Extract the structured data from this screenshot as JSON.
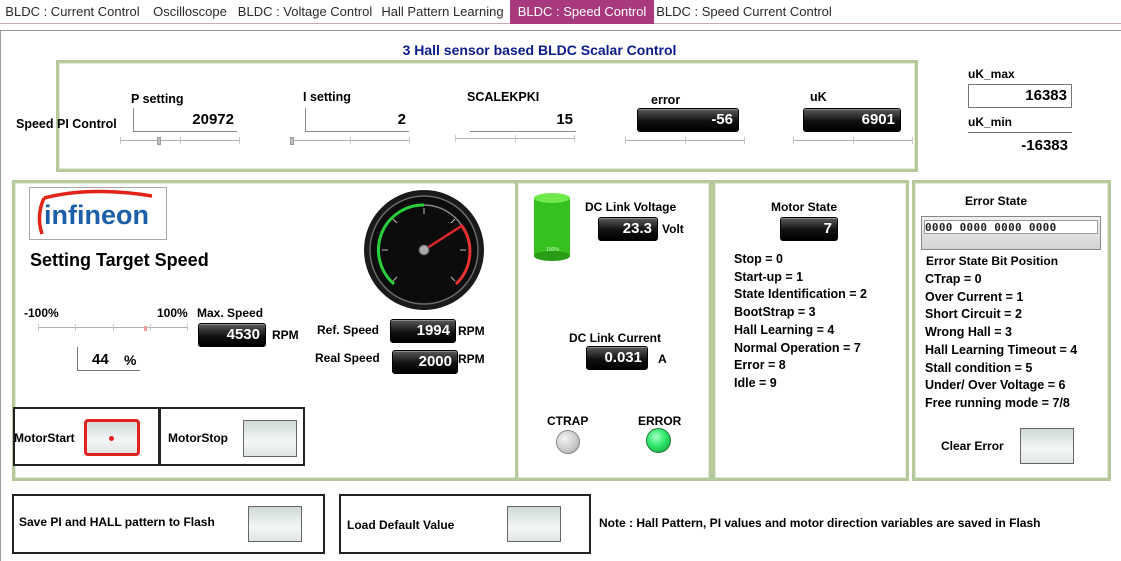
{
  "tabs": [
    {
      "label": "BLDC : Current  Control",
      "active": false
    },
    {
      "label": "Oscilloscope",
      "active": false
    },
    {
      "label": "BLDC : Voltage Control",
      "active": false
    },
    {
      "label": "Hall Pattern Learning",
      "active": false
    },
    {
      "label": "BLDC : Speed Control",
      "active": true
    },
    {
      "label": "BLDC : Speed Current Control",
      "active": false
    }
  ],
  "title": "3 Hall sensor based BLDC Scalar Control",
  "pi": {
    "section_label": "Speed PI Control",
    "p_label": "P setting",
    "p_value": "20972",
    "i_label": "I setting",
    "i_value": "2",
    "scale_label": "SCALEKPKI",
    "scale_value": "15",
    "error_label": "error",
    "error_value": "-56",
    "uk_label": "uK",
    "uk_value": "6901",
    "uk_max_label": "uK_max",
    "uk_max_value": "16383",
    "uk_min_label": "uK_min",
    "uk_min_value": "-16383"
  },
  "speed": {
    "logo_text": "infineon",
    "heading": "Setting Target Speed",
    "min_label": "-100%",
    "max_label": "100%",
    "percent_value": "44",
    "percent_unit": "%",
    "max_speed_label": "Max. Speed",
    "max_speed_value": "4530",
    "max_speed_unit": "RPM",
    "ref_label": "Ref. Speed",
    "ref_value": "1994",
    "ref_unit": "RPM",
    "real_label": "Real Speed",
    "real_value": "2000",
    "real_unit": "RPM",
    "start_label": "MotorStart",
    "stop_label": "MotorStop"
  },
  "dc": {
    "voltage_label": "DC Link Voltage",
    "voltage_value": "23.3",
    "voltage_unit": "Volt",
    "tank_label": "100%",
    "current_label": "DC Link Current",
    "current_value": "0.031",
    "current_unit": "A",
    "ctrap_label": "CTRAP",
    "error_label": "ERROR"
  },
  "motor_state": {
    "label": "Motor State",
    "value": "7",
    "items": [
      "Stop = 0",
      "Start-up = 1",
      "State Identification = 2",
      "BootStrap = 3",
      "Hall Learning = 4",
      "Normal Operation = 7",
      "Error = 8",
      "Idle = 9"
    ]
  },
  "error_state": {
    "label": "Error State",
    "bits": "0000 0000 0000 0000",
    "bit_position_label": "Error State Bit Position",
    "items": [
      "CTrap = 0",
      "Over Current = 1",
      "Short Circuit = 2",
      "Wrong Hall = 3",
      "Hall Learning Timeout = 4",
      "Stall condition = 5",
      "Under/ Over Voltage = 6",
      "Free running mode = 7/8"
    ],
    "clear_label": "Clear Error"
  },
  "flash": {
    "save_label": "Save PI and HALL pattern to Flash",
    "load_label": "Load Default Value",
    "note": "Note : Hall Pattern,  PI values and motor direction variables are saved in Flash"
  },
  "colors": {
    "accent": "#a8397c",
    "panel_border": "#b6c99c",
    "title": "#0b1a8a",
    "led_green": "#2ee86a",
    "start_red": "#e32020"
  }
}
